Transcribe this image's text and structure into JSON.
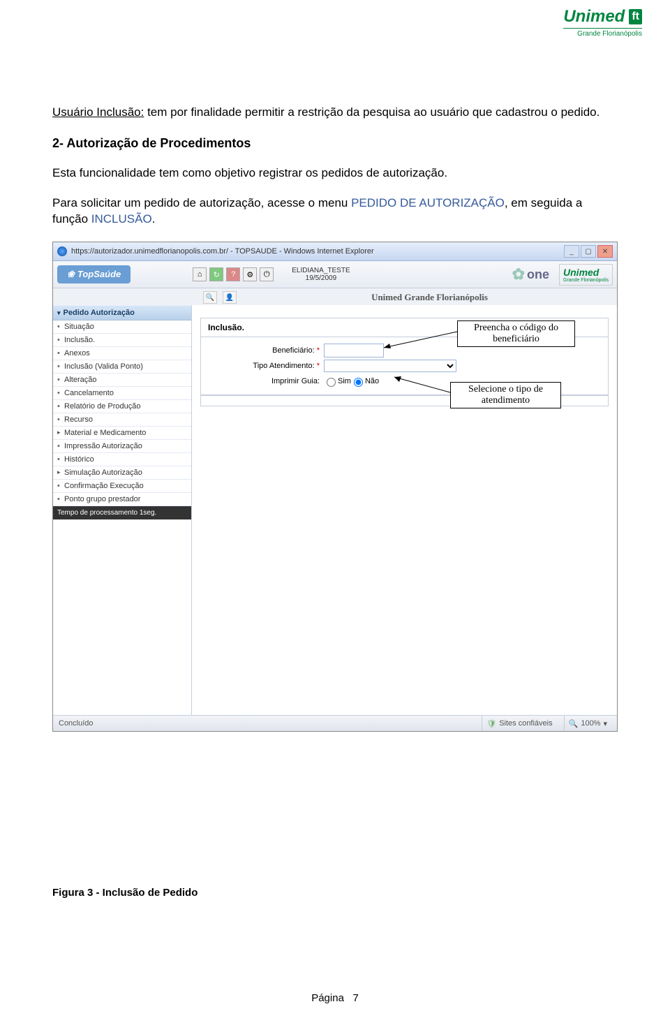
{
  "brand": {
    "name": "Unimed",
    "sub": "Grande Florianópolis",
    "box": "ft"
  },
  "doc": {
    "p1a": "Usuário Inclusão:",
    "p1b": " tem por finalidade permitir a restrição da pesquisa ao usuário que cadastrou o pedido.",
    "sec_title": "2- Autorização de Procedimentos",
    "p2": "Esta funcionalidade tem como objetivo registrar os pedidos de autorização.",
    "p3a": "Para solicitar um pedido de autorização, acesse o menu ",
    "p3b": "PEDIDO DE AUTORIZAÇÃO",
    "p3c": ", em seguida a função ",
    "p3d": "INCLUSÃO",
    "p3e": "."
  },
  "shot": {
    "title": "https://autorizador.unimedflorianopolis.com.br/ - TOPSAUDE - Windows Internet Explorer",
    "topsaude": "TopSaúde",
    "user_name": "ELIDIANA_TESTE",
    "user_date": "19/5/2009",
    "brand_center": "Unimed Grande Florianópolis",
    "one": "one",
    "sidebar": {
      "section": "Pedido Autorização",
      "items": [
        "Situação",
        "Inclusão.",
        "Anexos",
        "Inclusão (Valida Ponto)",
        "Alteração",
        "Cancelamento",
        "Relatório de Produção",
        "Recurso"
      ],
      "items_bold": [
        "Material e Medicamento",
        "Impressão Autorização",
        "Histórico",
        "Simulação Autorização",
        "Confirmação Execução",
        "Ponto grupo prestador"
      ],
      "footer": "Tempo de processamento 1seg."
    },
    "panel": {
      "title": "Inclusão.",
      "beneficiario_lbl": "Beneficiário:",
      "tipo_lbl": "Tipo Atendimento:",
      "imprimir_lbl": "Imprimir Guia:",
      "sim": "Sim",
      "nao": "Não"
    },
    "callout1": "Preencha o código do beneficiário",
    "callout2": "Selecione o tipo de atendimento",
    "status": {
      "left": "Concluído",
      "conf": "Sites confiáveis",
      "zoom": "100%"
    }
  },
  "figure": "Figura 3 - Inclusão de Pedido",
  "page_label": "Página",
  "page_no": "7"
}
